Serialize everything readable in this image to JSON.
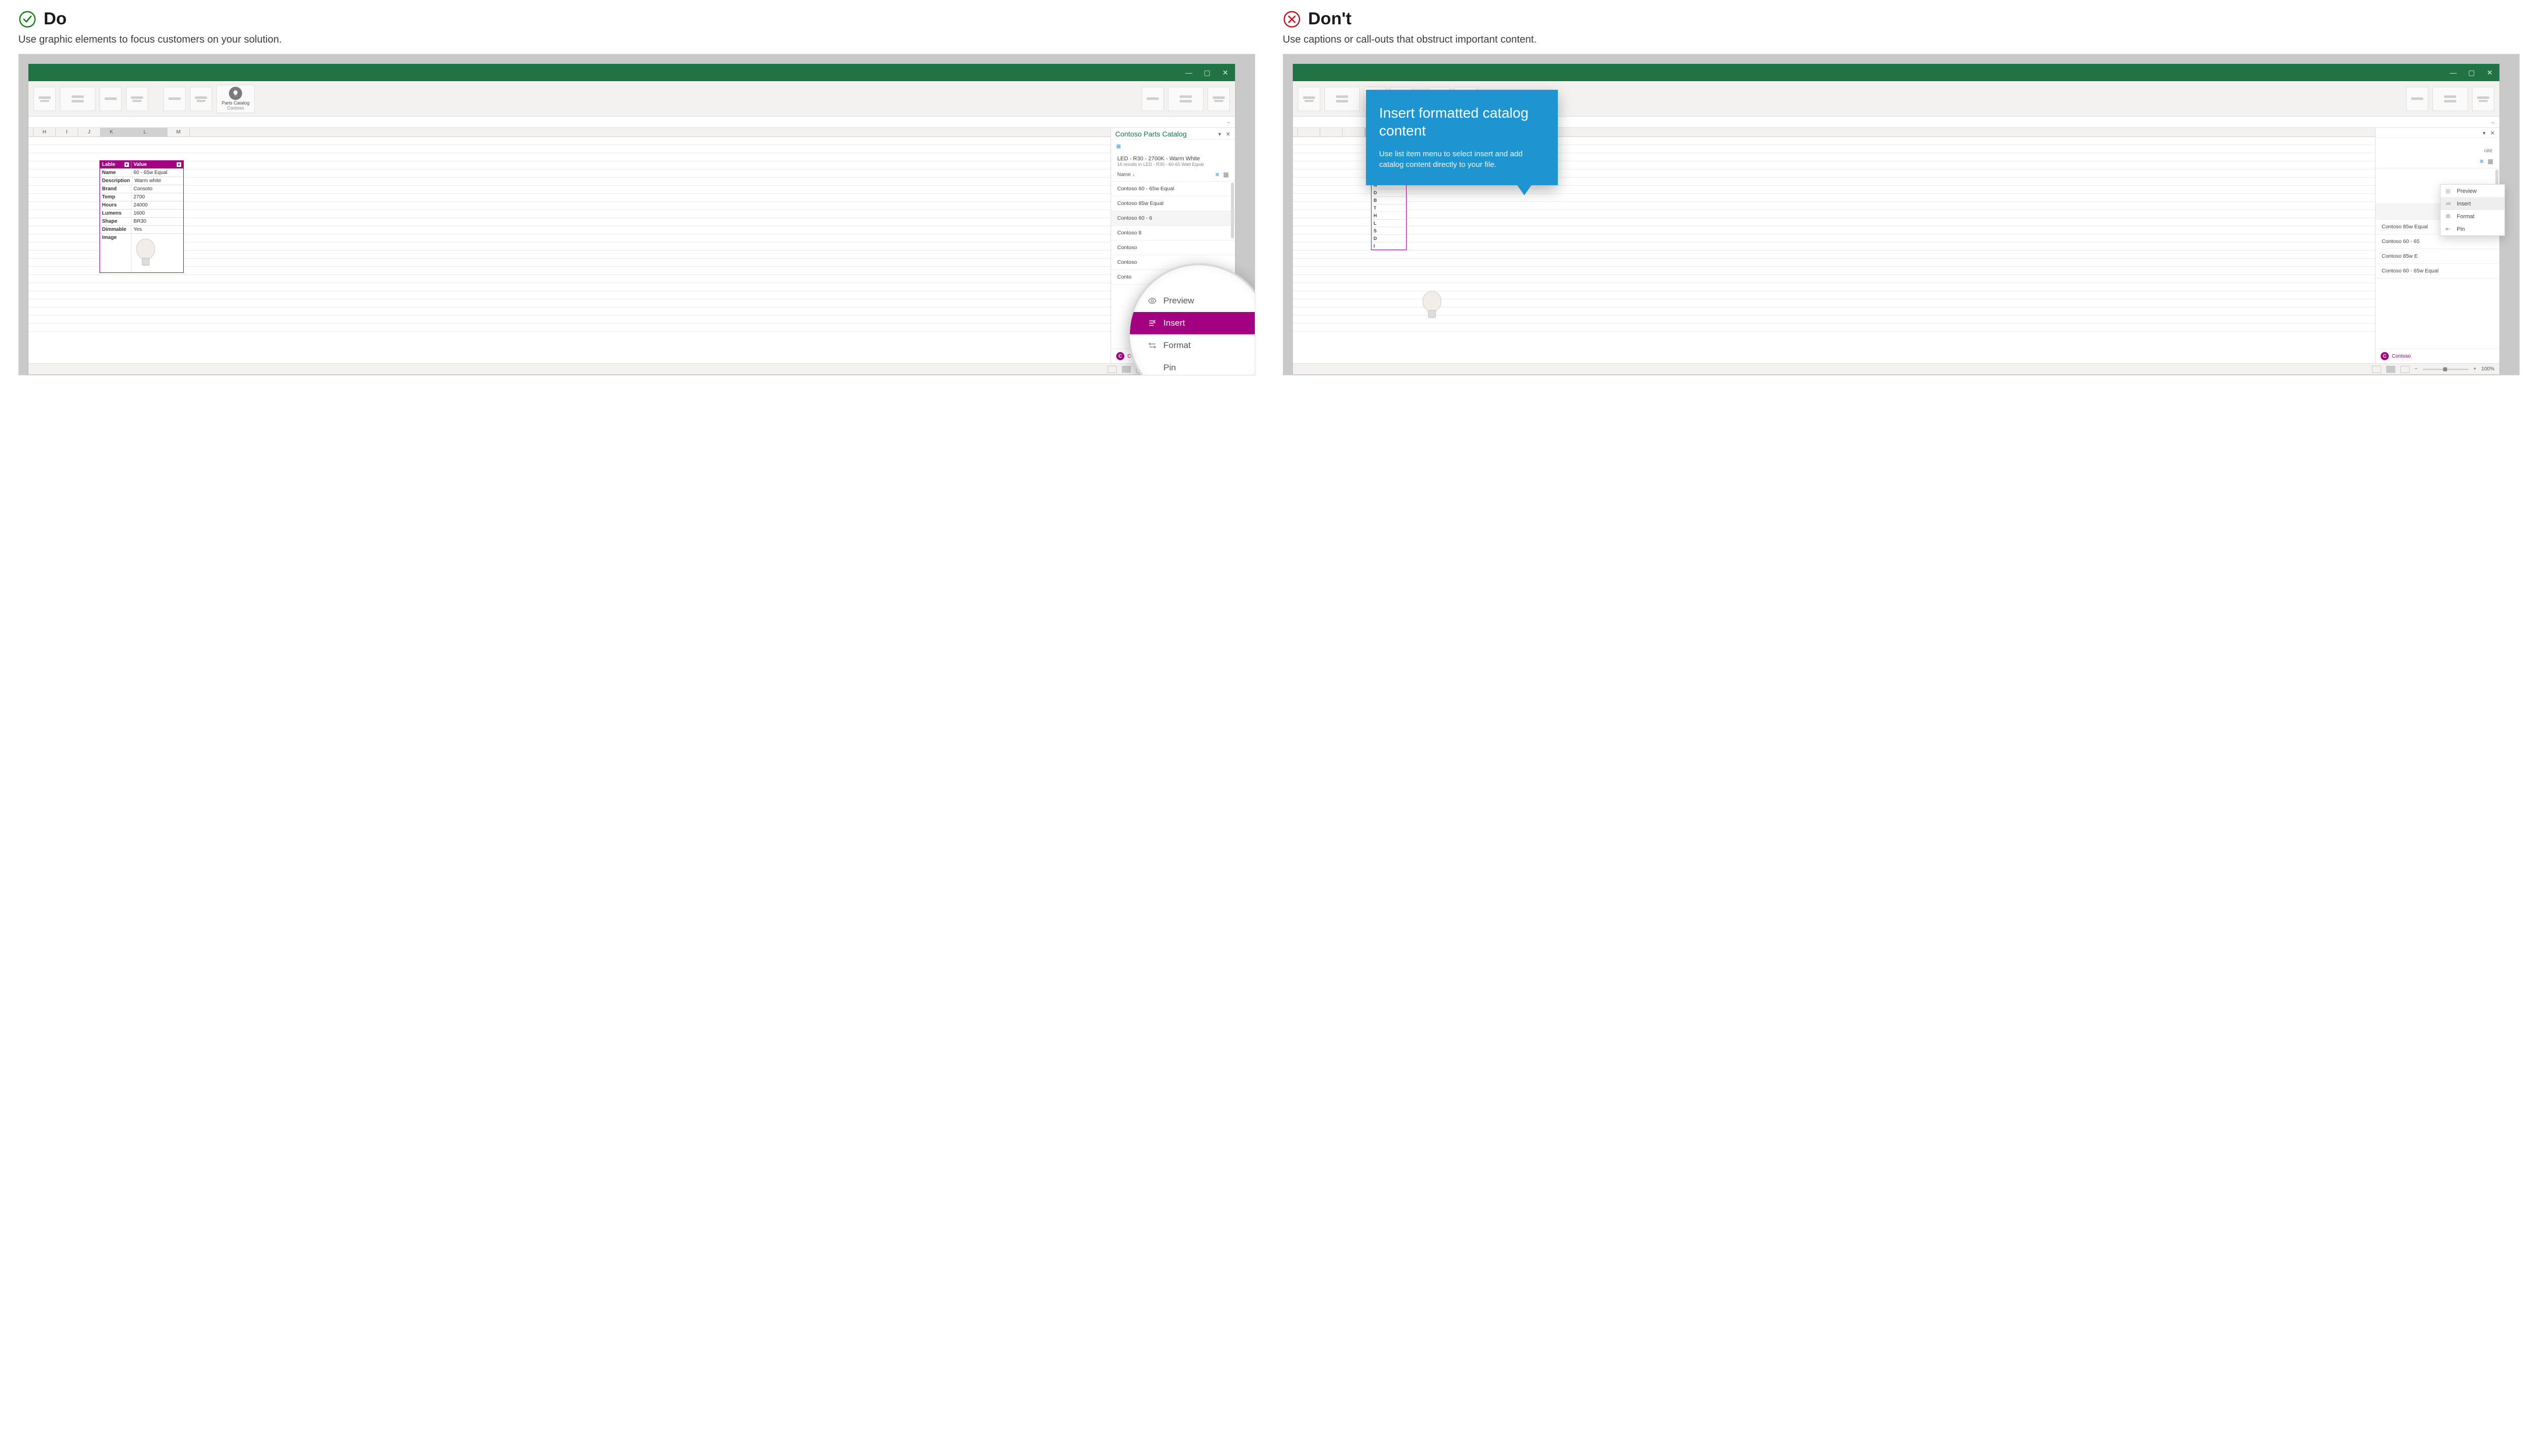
{
  "do": {
    "title": "Do",
    "subtitle": "Use graphic elements to focus customers on your solution."
  },
  "dont": {
    "title": "Don't",
    "subtitle": "Use captions or call-outs that obstruct important content."
  },
  "ribbon_addin": {
    "title": "Parts Catalog",
    "vendor": "Contoso"
  },
  "columns": [
    "H",
    "I",
    "J",
    "K",
    "L",
    "M"
  ],
  "table": {
    "headers": [
      "Lable",
      "Value"
    ],
    "rows": [
      {
        "k": "Name",
        "v": "60 - 65w Equal"
      },
      {
        "k": "Description",
        "v": "Warm white"
      },
      {
        "k": "Brand",
        "v": "Consoto"
      },
      {
        "k": "Temp",
        "v": "2700"
      },
      {
        "k": "Hours",
        "v": "24000"
      },
      {
        "k": "Lumens",
        "v": "1600"
      },
      {
        "k": "Shape",
        "v": "BR30"
      },
      {
        "k": "Dimmable",
        "v": "Yes"
      },
      {
        "k": "Image",
        "v": ""
      }
    ]
  },
  "pane": {
    "title": "Contoso Parts Catalog",
    "breadcrumb": "LED - R30 - 2700K - Warm White",
    "breadcrumb_sub": "16 results in LED - R30 - 60-65 Watt Equal",
    "list_col": "Name",
    "items": [
      "Contoso 60 - 65w Equal",
      "Contoso 85w Equal",
      "Contoso 60 - 65w Equal",
      "Contoso 85w Equal",
      "Contoso 60 - 65w Equal",
      "Contoso 85w Equal",
      "Contoso 60 - 65w Equal"
    ],
    "items_trunc": [
      "Contoso 60 - 6",
      "Contoso 8",
      "Contoso",
      "Contoso",
      "Conto"
    ],
    "footer": "Contoso",
    "footer_trunc": "Contos"
  },
  "mag_menu": [
    "Preview",
    "Insert",
    "Format",
    "Pin"
  ],
  "ctx_menu": [
    "Preview",
    "Insert",
    "Format",
    "Pin"
  ],
  "callout": {
    "title": "Insert formatted catalog content",
    "body": "Use list item menu to select insert and add catalog content directly to your file."
  },
  "status": {
    "zoom": "100%"
  },
  "under": [
    "N",
    "D",
    "B",
    "T",
    "H",
    "L",
    "S",
    "D",
    "I"
  ],
  "dont_items_partial": [
    "Contoso 85w Equal",
    "Contoso 60 - 65",
    "Contoso 85w E",
    "Contoso 60 - 65w Equal"
  ]
}
